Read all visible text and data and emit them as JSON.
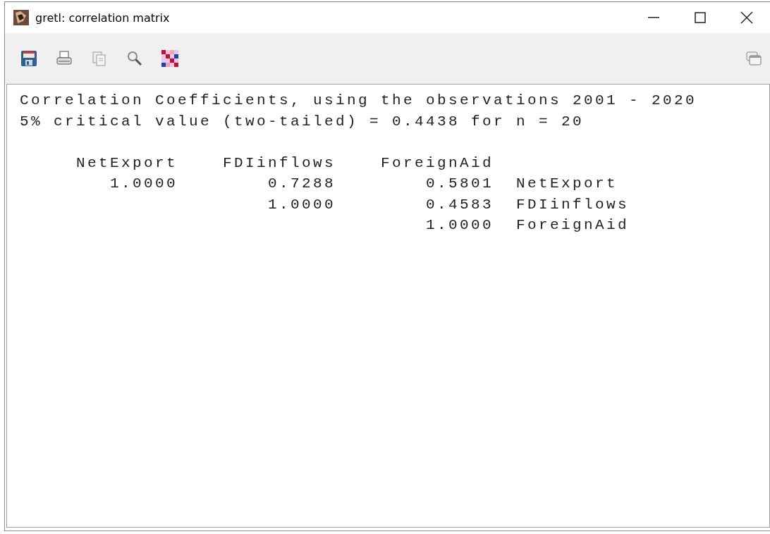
{
  "window": {
    "title": "gretl: correlation matrix"
  },
  "output": {
    "lines": [
      "Correlation Coefficients, using the observations 2001 - 2020",
      "5% critical value (two-tailed) = 0.4438 for n = 20"
    ],
    "columns": [
      "NetExport",
      "FDIinflows",
      "ForeignAid"
    ],
    "rows": [
      {
        "values": [
          "1.0000",
          "0.7288",
          "0.5801"
        ],
        "label": "NetExport"
      },
      {
        "values": [
          "1.0000",
          "0.4583"
        ],
        "label": "FDIinflows"
      },
      {
        "values": [
          "1.0000"
        ],
        "label": "ForeignAid"
      }
    ]
  }
}
